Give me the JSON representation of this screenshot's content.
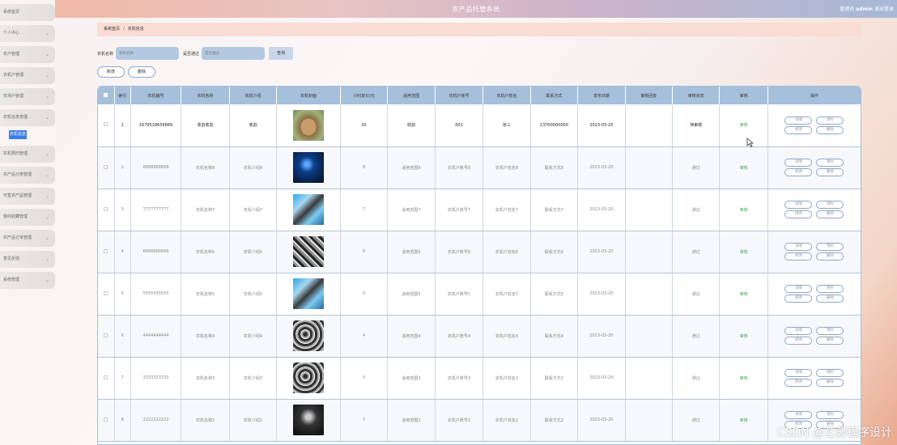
{
  "header": {
    "title": "农产品托管系统",
    "user_label": "管理员",
    "user_name": "admin",
    "logout": "退出登录"
  },
  "sidebar": {
    "items": [
      {
        "label": "系统首页",
        "has_arrow": false
      },
      {
        "label": "个人中心",
        "has_arrow": true
      },
      {
        "label": "农户管理",
        "has_arrow": true
      },
      {
        "label": "农机户管理",
        "has_arrow": true
      },
      {
        "label": "农场户管理",
        "has_arrow": true
      },
      {
        "label": "农机信息管理",
        "has_arrow": true
      },
      {
        "label": "农机预约管理",
        "has_arrow": true
      },
      {
        "label": "农产品分类管理",
        "has_arrow": true
      },
      {
        "label": "可售农产品管理",
        "has_arrow": true
      },
      {
        "label": "我的收藏管理",
        "has_arrow": true
      },
      {
        "label": "农产品订单管理",
        "has_arrow": true
      },
      {
        "label": "意见反馈",
        "has_arrow": true
      },
      {
        "label": "系统管理",
        "has_arrow": true
      }
    ],
    "active_sub": "农机信息"
  },
  "breadcrumb": {
    "home": "系统首页",
    "separator": "/",
    "current": "农机信息"
  },
  "search": {
    "field1_label": "农机名称",
    "field1_placeholder": "农机名称",
    "field2_label": "是否通过",
    "field2_placeholder": "是否通过",
    "query_button": "查询"
  },
  "actions": {
    "add": "新增",
    "delete": "删除"
  },
  "table": {
    "columns": [
      "",
      "索引",
      "农机编号",
      "农机名称",
      "农机介绍",
      "农机封面",
      "小时单价/元",
      "适用范围",
      "农机户账号",
      "农机户姓名",
      "联系方式",
      "发布日期",
      "审核回复",
      "审核状态",
      "审核",
      "操作"
    ],
    "audit_link": "审核",
    "ops": [
      "详情",
      "预约",
      "修改",
      "删除"
    ],
    "rows": [
      {
        "idx": "1",
        "code": "1679518656889",
        "name": "收割收割",
        "intro": "收割",
        "img": "rabbit",
        "price": "20",
        "scope": "收割",
        "account": "001",
        "owner": "张三",
        "phone": "13700000000",
        "date": "2023-03-20",
        "reply": "",
        "status": "待审核"
      },
      {
        "idx": "2",
        "code": "8888888888",
        "name": "农机名称8",
        "intro": "农机介绍8",
        "img": "blue",
        "price": "8",
        "scope": "适用范围8",
        "account": "农机户账号8",
        "owner": "农机户姓名8",
        "phone": "联系方式8",
        "date": "2023-03-20",
        "reply": "",
        "status": "通过"
      },
      {
        "idx": "3",
        "code": "7777777777",
        "name": "农机名称7",
        "intro": "农机介绍7",
        "img": "tool",
        "price": "7",
        "scope": "适用范围7",
        "account": "农机户账号7",
        "owner": "农机户姓名7",
        "phone": "联系方式7",
        "date": "2023-03-20",
        "reply": "",
        "status": "通过"
      },
      {
        "idx": "4",
        "code": "6666666666",
        "name": "农机名称6",
        "intro": "农机介绍6",
        "img": "metal",
        "price": "6",
        "scope": "适用范围6",
        "account": "农机户账号6",
        "owner": "农机户姓名6",
        "phone": "联系方式6",
        "date": "2023-03-20",
        "reply": "",
        "status": "通过"
      },
      {
        "idx": "5",
        "code": "5555555555",
        "name": "农机名称5",
        "intro": "农机介绍5",
        "img": "tool",
        "price": "5",
        "scope": "适用范围5",
        "account": "农机户账号5",
        "owner": "农机户姓名5",
        "phone": "联系方式5",
        "date": "2023-03-20",
        "reply": "",
        "status": "通过"
      },
      {
        "idx": "6",
        "code": "4444444444",
        "name": "农机名称4",
        "intro": "农机介绍4",
        "img": "metal2",
        "price": "4",
        "scope": "适用范围4",
        "account": "农机户账号4",
        "owner": "农机户姓名4",
        "phone": "联系方式4",
        "date": "2023-03-20",
        "reply": "",
        "status": "通过"
      },
      {
        "idx": "7",
        "code": "3333333333",
        "name": "农机名称3",
        "intro": "农机介绍3",
        "img": "metal2",
        "price": "3",
        "scope": "适用范围3",
        "account": "农机户账号3",
        "owner": "农机户姓名3",
        "phone": "联系方式3",
        "date": "2023-03-20",
        "reply": "",
        "status": "通过"
      },
      {
        "idx": "8",
        "code": "2222222222",
        "name": "农机名称2",
        "intro": "农机介绍2",
        "img": "dark",
        "price": "2",
        "scope": "适用范围2",
        "account": "农机户账号2",
        "owner": "农机户姓名2",
        "phone": "联系方式2",
        "date": "2023-03-20",
        "reply": "",
        "status": "通过"
      }
    ]
  },
  "watermark": "CSDN @艺馨程序设计"
}
